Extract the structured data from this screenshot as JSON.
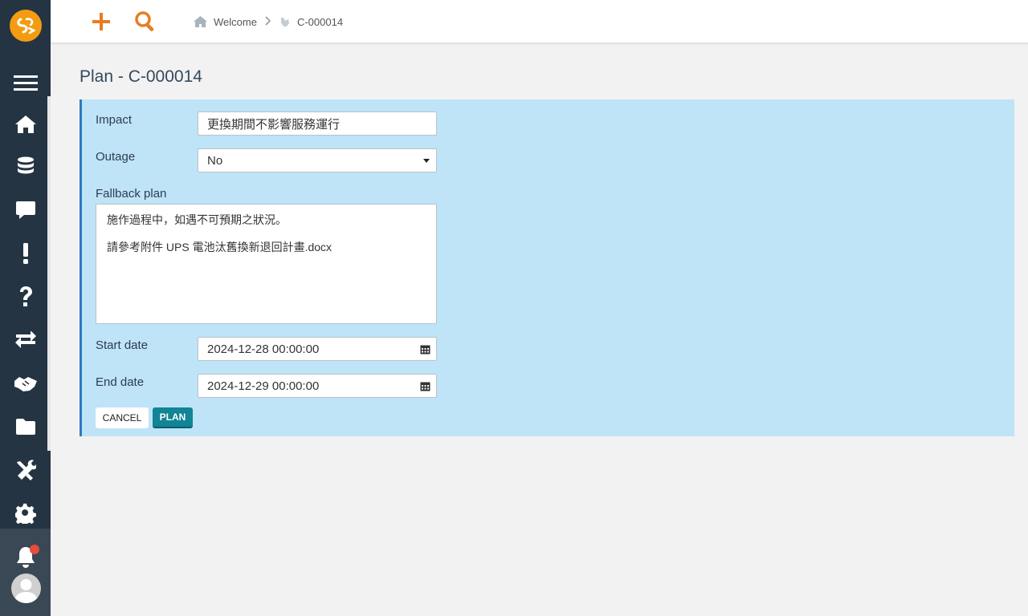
{
  "sidebar": {
    "items": [
      {
        "icon": "menu-icon"
      },
      {
        "icon": "home-icon"
      },
      {
        "icon": "database-icon"
      },
      {
        "icon": "comment-icon"
      },
      {
        "icon": "exclamation-icon"
      },
      {
        "icon": "question-icon"
      },
      {
        "icon": "exchange-icon"
      },
      {
        "icon": "handshake-icon"
      },
      {
        "icon": "folder-icon"
      },
      {
        "icon": "tools-icon"
      },
      {
        "icon": "gear-icon"
      }
    ],
    "notification_color": "#e74c3c"
  },
  "topbar": {
    "add_icon": "plus-icon",
    "search_icon": "search-icon",
    "accent_color": "#e67e22",
    "breadcrumb": [
      {
        "label": "Welcome",
        "icon": "home-icon"
      },
      {
        "label": "C-000014",
        "icon": "change-icon"
      }
    ]
  },
  "page": {
    "title": "Plan - C-000014"
  },
  "form": {
    "impact_label": "Impact",
    "impact_value": "更換期間不影響服務運行",
    "outage_label": "Outage",
    "outage_value": "No",
    "fallback_label": "Fallback plan",
    "fallback_line1": "施作過程中，如遇不可預期之狀況。",
    "fallback_line2": "請參考附件 UPS 電池汰舊換新退回計畫.docx",
    "start_label": "Start date",
    "start_value": "2024-12-28 00:00:00",
    "end_label": "End date",
    "end_value": "2024-12-29 00:00:00",
    "cancel_label": "CANCEL",
    "plan_label": "PLAN"
  }
}
